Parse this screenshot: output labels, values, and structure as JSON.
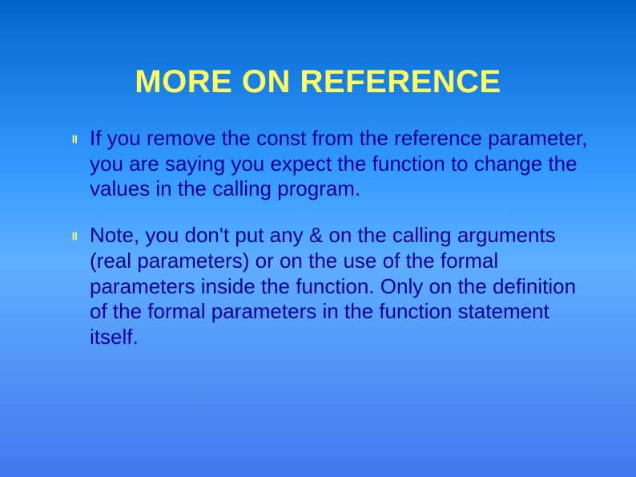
{
  "slide": {
    "title": "MORE ON REFERENCE",
    "bullets": [
      {
        "marker": "❙❙",
        "text": "If you remove the const from the reference parameter, you are saying you expect the function to change the values in the calling program."
      },
      {
        "marker": "❙❙",
        "text": "Note, you don't put any & on the calling arguments (real parameters) or on the use of the formal parameters inside the function. Only on the definition of the formal parameters in the function statement itself."
      }
    ]
  }
}
